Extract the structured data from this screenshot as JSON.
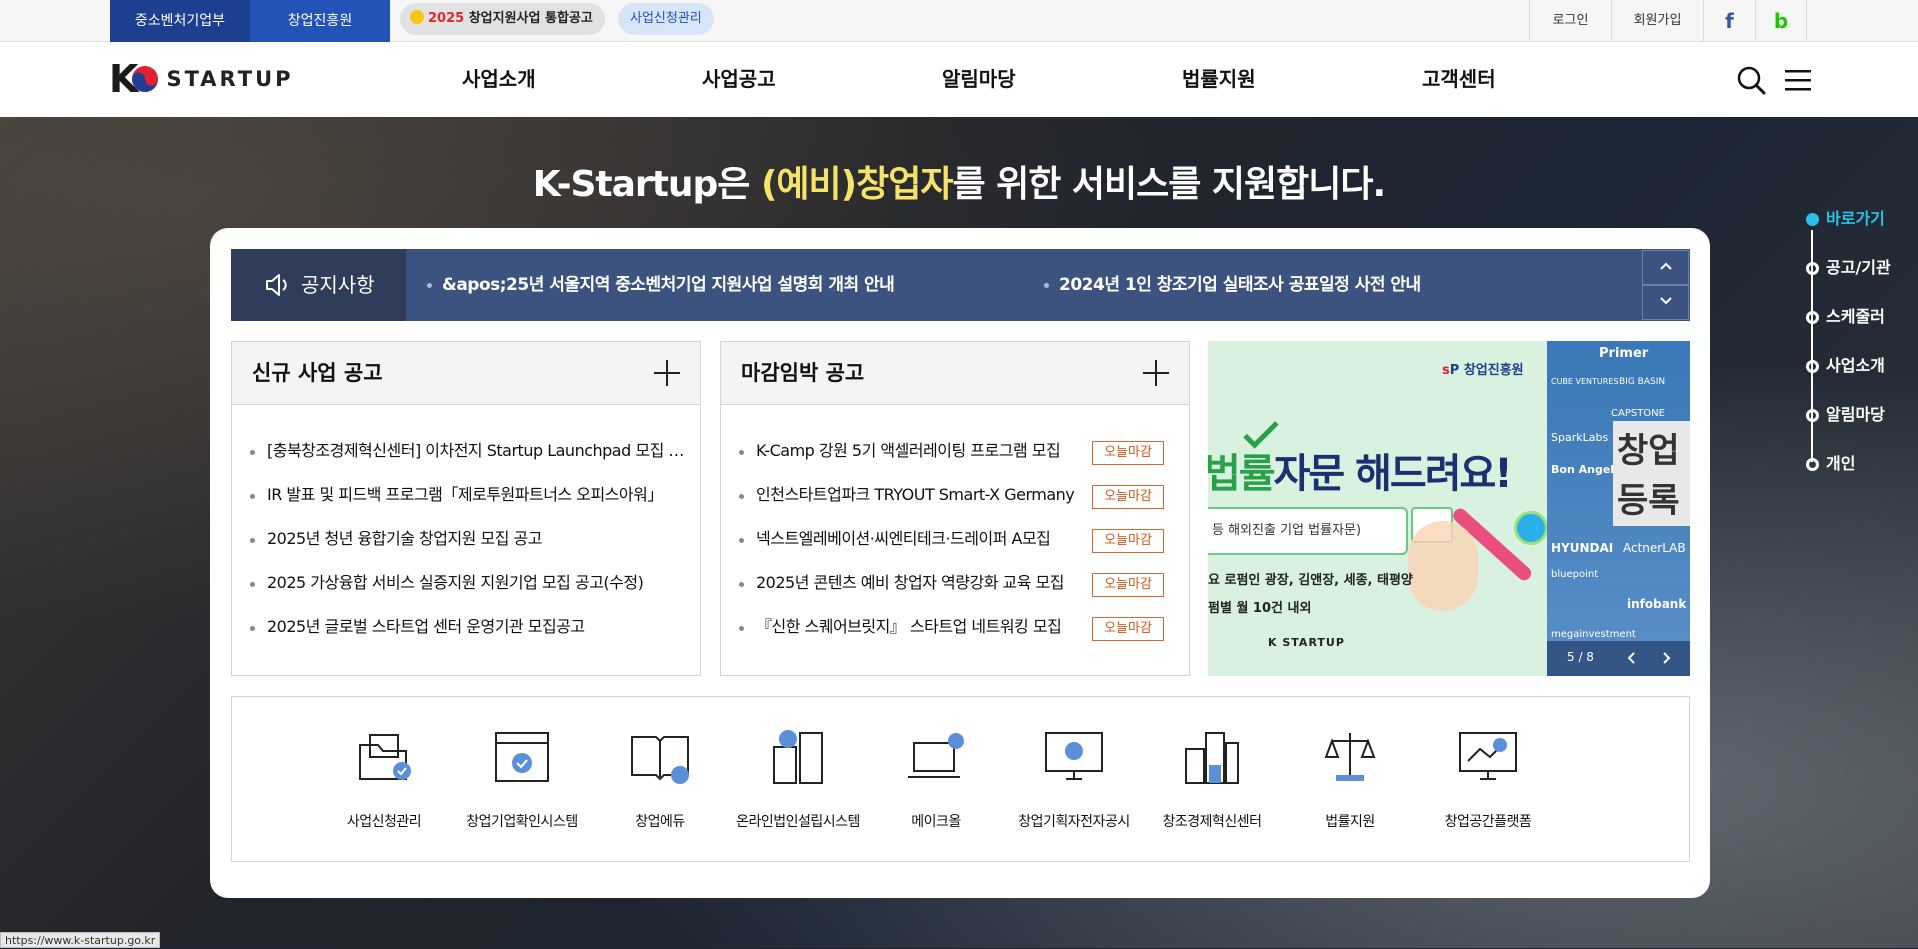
{
  "topbar": {
    "org1": "중소벤처기업부",
    "org2": "창업진흥원",
    "promo_year": "2025",
    "promo_text": "창업지원사업 통합공고",
    "apply_mgmt": "사업신청관리",
    "login": "로그인",
    "signup": "회원가입",
    "facebook": "f",
    "blog": "b",
    "colors": {
      "org1": "#1d3f8f",
      "org2": "#2453b8",
      "pill": "#e2e2e2",
      "pill2": "#d7e6f6"
    }
  },
  "header": {
    "logo_k": "K",
    "logo_text": "STARTUP",
    "menu": [
      "사업소개",
      "사업공고",
      "알림마당",
      "법률지원",
      "고객센터"
    ],
    "search_icon": "search-icon",
    "menu_icon": "hamburger-icon"
  },
  "hero": {
    "headline_pre": "K-Startup은 ",
    "headline_highlight": "(예비)창업자",
    "headline_post": "를 위한 서비스를 지원합니다."
  },
  "notice": {
    "label": "공지사항",
    "items": [
      "&apos;25년 서울지역 중소벤처기업 지원사업 설명회 개최 안내",
      "2024년 1인 창조기업 실태조사 공표일정 사전 안내"
    ]
  },
  "new_posts": {
    "title": "신규 사업 공고",
    "items": [
      "[충북창조경제혁신센터] 이차전지 Startup Launchpad 모집 공고",
      "IR 발표 및 피드백 프로그램「제로투원파트너스 오피스아워」",
      "2025년 청년 융합기술 창업지원 모집 공고",
      "2025 가상융합 서비스 실증지원 지원기업 모집 공고(수정)",
      "2025년 글로벌 스타트업 센터 운영기관 모집공고"
    ]
  },
  "deadline_posts": {
    "title": "마감임박 공고",
    "badge": "오늘마감",
    "items": [
      "K-Camp 강원 5기 액셀러레이팅 프로그램 모집",
      "인천스타트업파크 TRYOUT Smart-X Germany",
      "넥스트엘레베이션·씨엔티테크·드레이퍼 A모집",
      "2025년 콘텐츠 예비 창업자 역량강화 교육 모집",
      "『신한 스퀘어브릿지』 스타트업 네트워킹 모집"
    ]
  },
  "banner": {
    "org": "창업진흥원",
    "headline_a": "법률",
    "headline_b": "자문 해드려요!",
    "sub": "등 해외진출 기업 법률자문)",
    "line1": "요 로펌인 광장, 김앤장, 세종, 태평양",
    "line2": "펌별 월 10건 내외",
    "logo": "K STARTUP",
    "right_words": [
      "Primer",
      "BIG BASIN",
      "CUBE VENTURES",
      "CAPSTONE",
      "SparkLabs",
      "Bon Angels",
      "HYUNDAI",
      "ActnerLAB",
      "bluepoint",
      "infobank",
      "megainvestment"
    ],
    "right_big": [
      "창업",
      "등록"
    ],
    "counter": "5 / 8"
  },
  "services": [
    {
      "label": "사업신청관리",
      "icon": "folder-check-icon"
    },
    {
      "label": "창업기업확인시스템",
      "icon": "window-check-icon"
    },
    {
      "label": "창업에듀",
      "icon": "book-home-icon"
    },
    {
      "label": "온라인법인설립시스템",
      "icon": "building-chat-icon"
    },
    {
      "label": "메이크올",
      "icon": "laptop-gear-icon"
    },
    {
      "label": "창업기획자전자공시",
      "icon": "monitor-doc-icon"
    },
    {
      "label": "창조경제혁신센터",
      "icon": "buildings-icon"
    },
    {
      "label": "법률지원",
      "icon": "scale-icon"
    },
    {
      "label": "창업공간플랫폼",
      "icon": "monitor-map-icon"
    }
  ],
  "quick": {
    "items": [
      "바로가기",
      "공고/기관",
      "스케줄러",
      "사업소개",
      "알림마당",
      "개인"
    ],
    "active_color": "#2bc1e6"
  },
  "statusbar": {
    "url": "https://www.k-startup.go.kr"
  }
}
